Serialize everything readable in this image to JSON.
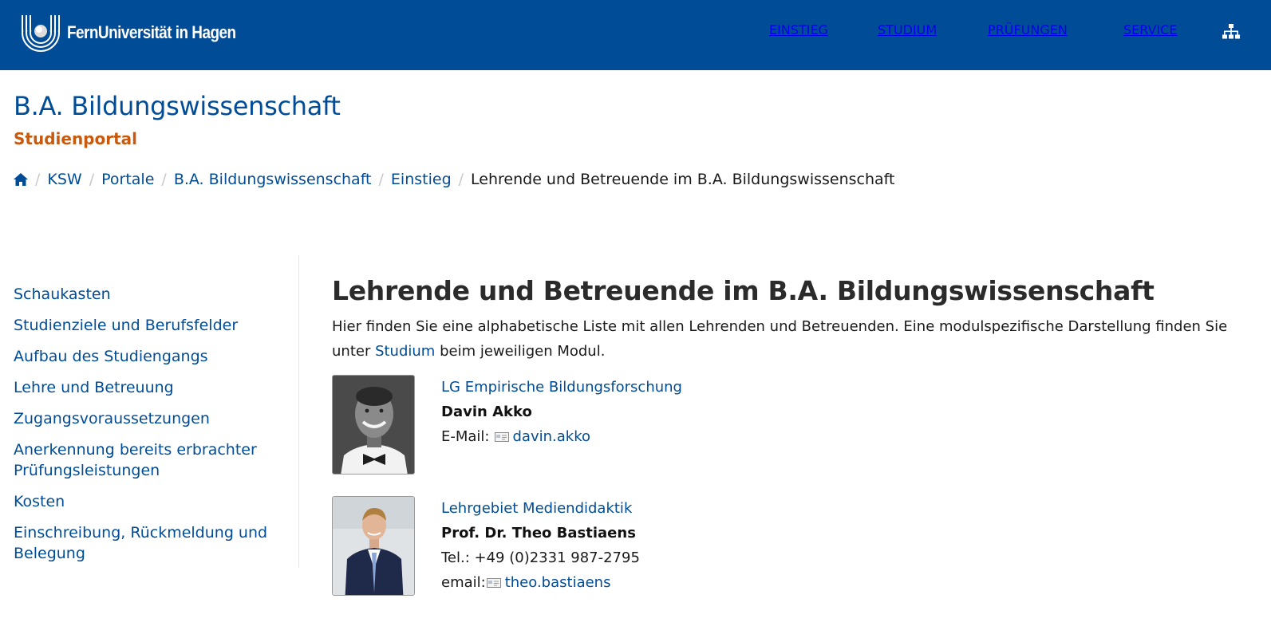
{
  "header": {
    "logo_text": "FernUniversität in Hagen",
    "nav": [
      "EINSTIEG",
      "STUDIUM",
      "PRÜFUNGEN",
      "SERVICE"
    ],
    "sitemap_icon": "sitemap-icon",
    "colors": {
      "bar": "#004c97",
      "text": "#ffffff"
    }
  },
  "portal": {
    "title": "B.A. Bildungswissenschaft",
    "subtitle": "Studienportal",
    "colors": {
      "title": "#004c97",
      "subtitle": "#c85a0f"
    }
  },
  "breadcrumb": {
    "home_icon": "home-icon",
    "items": [
      "KSW",
      "Portale",
      "B.A. Bildungswissenschaft",
      "Einstieg"
    ],
    "current": "Lehrende und Betreuende im B.A. Bildungswissenschaft",
    "separator": "/"
  },
  "sidebar": {
    "items": [
      "Schaukasten",
      "Studienziele und Berufsfelder",
      "Aufbau des Studiengangs",
      "Lehre und Betreuung",
      "Zugangsvoraussetzungen",
      "Anerkennung bereits erbrachter Prüfungsleistungen",
      "Kosten",
      "Einschreibung, Rückmeldung und Belegung"
    ]
  },
  "main": {
    "heading": "Lehrende und Betreuende im B.A. Bildungswissenschaft",
    "intro_before": "Hier finden Sie eine alphabetische Liste mit allen Lehrenden und Betreuenden. Eine modulspezifische Darstellung finden Sie unter ",
    "intro_link": "Studium",
    "intro_after": " beim jeweiligen Modul.",
    "people": [
      {
        "unit": "LG Empirische Bildungsforschung",
        "name": "Davin Akko",
        "email_label": "E-Mail:",
        "email": "davin.akko"
      },
      {
        "unit": "Lehrgebiet Mediendidaktik",
        "name": "Prof. Dr. Theo Bastiaens",
        "phone": "Tel.: +49 (0)2331 987-2795",
        "email_label": "email:",
        "email": "theo.bastiaens"
      }
    ]
  }
}
